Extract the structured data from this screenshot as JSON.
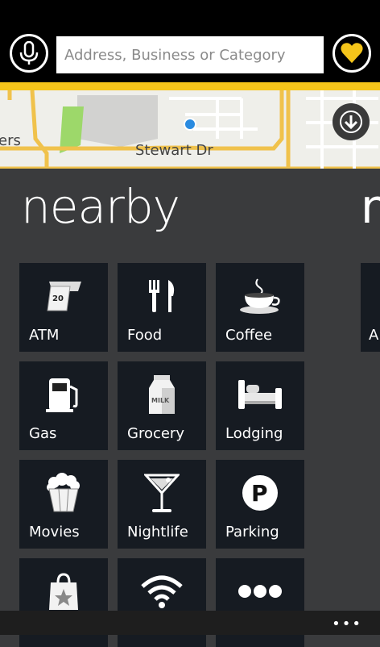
{
  "search": {
    "placeholder": "Address, Business or Category"
  },
  "map": {
    "street_label": "Stewart Dr",
    "partial_label": "ers"
  },
  "nearby": {
    "title": "nearby",
    "next_title_peek": "n",
    "next_tile_peek": "A",
    "tiles": [
      {
        "label": "ATM",
        "icon": "atm-icon"
      },
      {
        "label": "Food",
        "icon": "food-icon"
      },
      {
        "label": "Coffee",
        "icon": "coffee-icon"
      },
      {
        "label": "Gas",
        "icon": "gas-icon"
      },
      {
        "label": "Grocery",
        "icon": "grocery-icon"
      },
      {
        "label": "Lodging",
        "icon": "lodging-icon"
      },
      {
        "label": "Movies",
        "icon": "movies-icon"
      },
      {
        "label": "Nightlife",
        "icon": "nightlife-icon"
      },
      {
        "label": "Parking",
        "icon": "parking-icon"
      },
      {
        "label": "",
        "icon": "shopping-icon"
      },
      {
        "label": "",
        "icon": "wifi-icon"
      },
      {
        "label": "",
        "icon": "more-icon"
      }
    ]
  },
  "appbar": {
    "more": "•••"
  },
  "colors": {
    "accent": "#f5c51a",
    "tile_bg": "#161b22",
    "page_bg": "#3a3b3d"
  }
}
